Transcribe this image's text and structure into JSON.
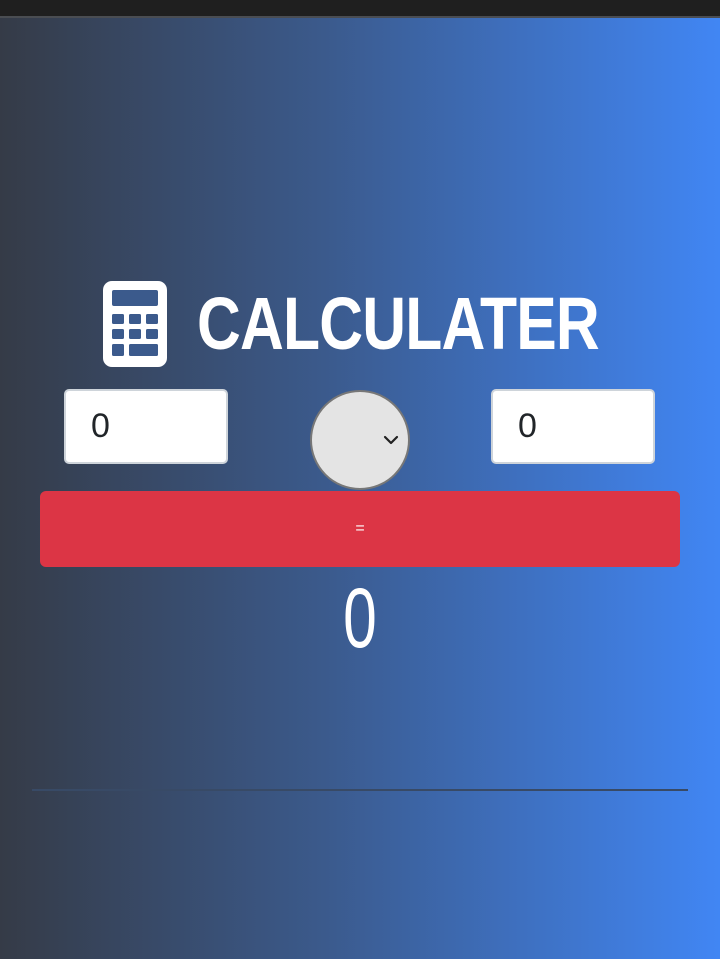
{
  "header": {
    "title": "CALCULATER",
    "icon": "calculator-icon"
  },
  "inputs": {
    "first_value": "0",
    "second_value": "0"
  },
  "operator": {
    "selected": "",
    "icon": "chevron-down-icon"
  },
  "equals_label": "=",
  "result": "0",
  "colors": {
    "gradient_start": "#353b47",
    "gradient_end": "#4186f4",
    "button": "#dc3545",
    "title": "#ffffff"
  }
}
